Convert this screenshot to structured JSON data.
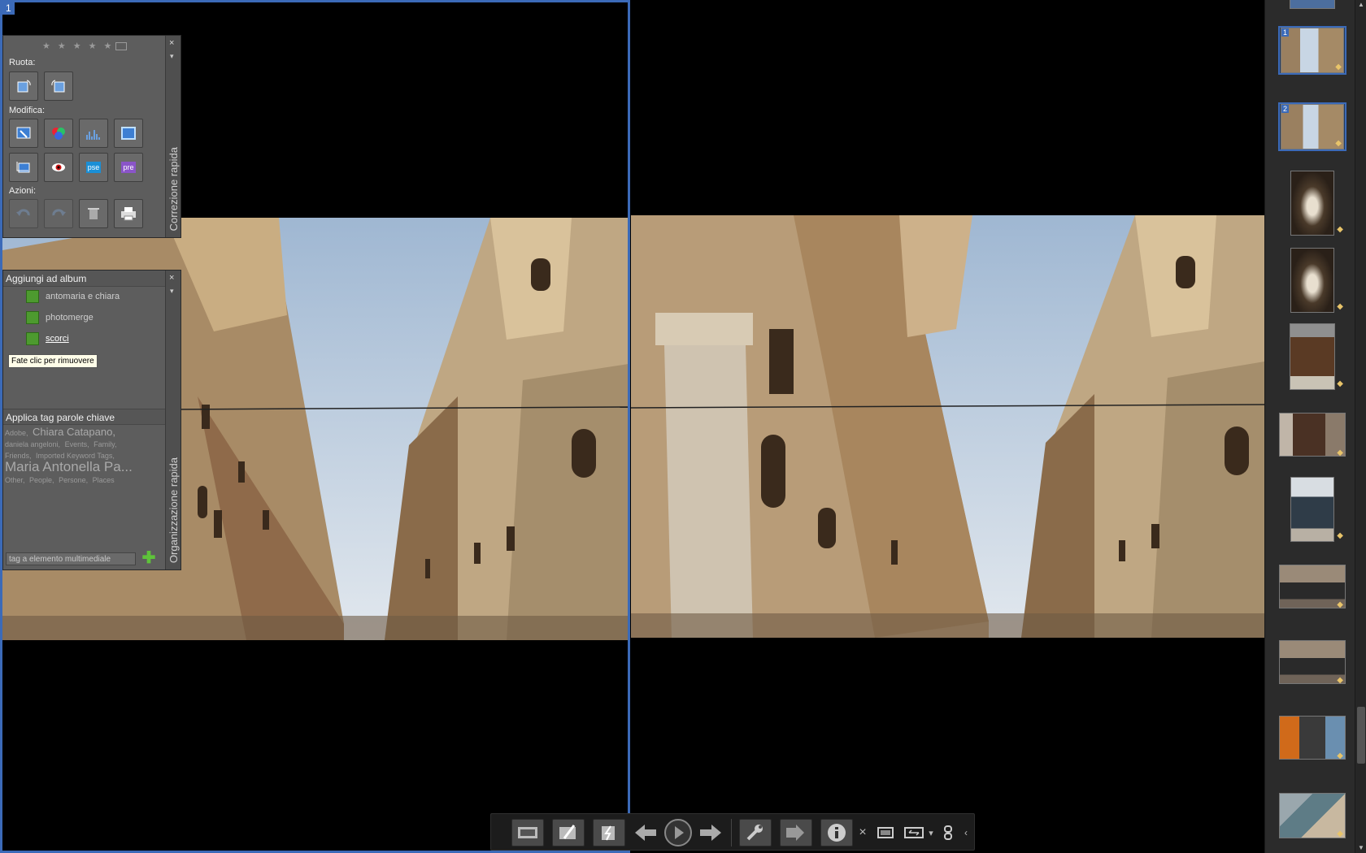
{
  "viewer1": {
    "number": "1"
  },
  "quickfix": {
    "title": "Correzione rapida",
    "rotate_label": "Ruota:",
    "edit_label": "Modifica:",
    "actions_label": "Azioni:",
    "close": "×",
    "pin": "▾",
    "buttons": {
      "pse": "pse",
      "pre": "pre"
    }
  },
  "organize": {
    "title": "Organizzazione rapida",
    "close": "×",
    "pin": "▾",
    "album_header": "Aggiungi ad album",
    "albums": [
      "antomaria e chiara",
      "photomerge",
      "scorci"
    ],
    "tooltip": "Fate clic per rimuovere",
    "keyword_header": "Applica tag parole chiave",
    "keywords": [
      "Adobe,",
      "Chiara Catapano,",
      "daniela angeloni,",
      "Events,",
      "Family,",
      "Friends,",
      "Imported Keyword Tags,",
      "Maria Antonella Pa...",
      "Other,",
      "People,",
      "Persone,",
      "Places"
    ],
    "tag_input_placeholder": "tag a elemento multimediale",
    "add": "✚"
  },
  "filmstrip": {
    "thumbs": [
      {
        "num": "1",
        "selected": true
      },
      {
        "num": "2",
        "selected": true
      },
      {
        "num": "",
        "selected": false
      },
      {
        "num": "",
        "selected": false
      },
      {
        "num": "",
        "selected": false
      },
      {
        "num": "",
        "selected": false
      },
      {
        "num": "",
        "selected": false
      },
      {
        "num": "",
        "selected": false
      },
      {
        "num": "",
        "selected": false
      },
      {
        "num": "",
        "selected": false
      },
      {
        "num": "",
        "selected": false
      }
    ],
    "scroll_up": "▲",
    "scroll_down": "▼"
  },
  "toolbar": {
    "close": "×",
    "dropdown": "▾",
    "collapse": "‹"
  },
  "colors": {
    "accent": "#3b6ab8",
    "panel": "#5d5d5d",
    "album_green": "#4d9a2f"
  }
}
